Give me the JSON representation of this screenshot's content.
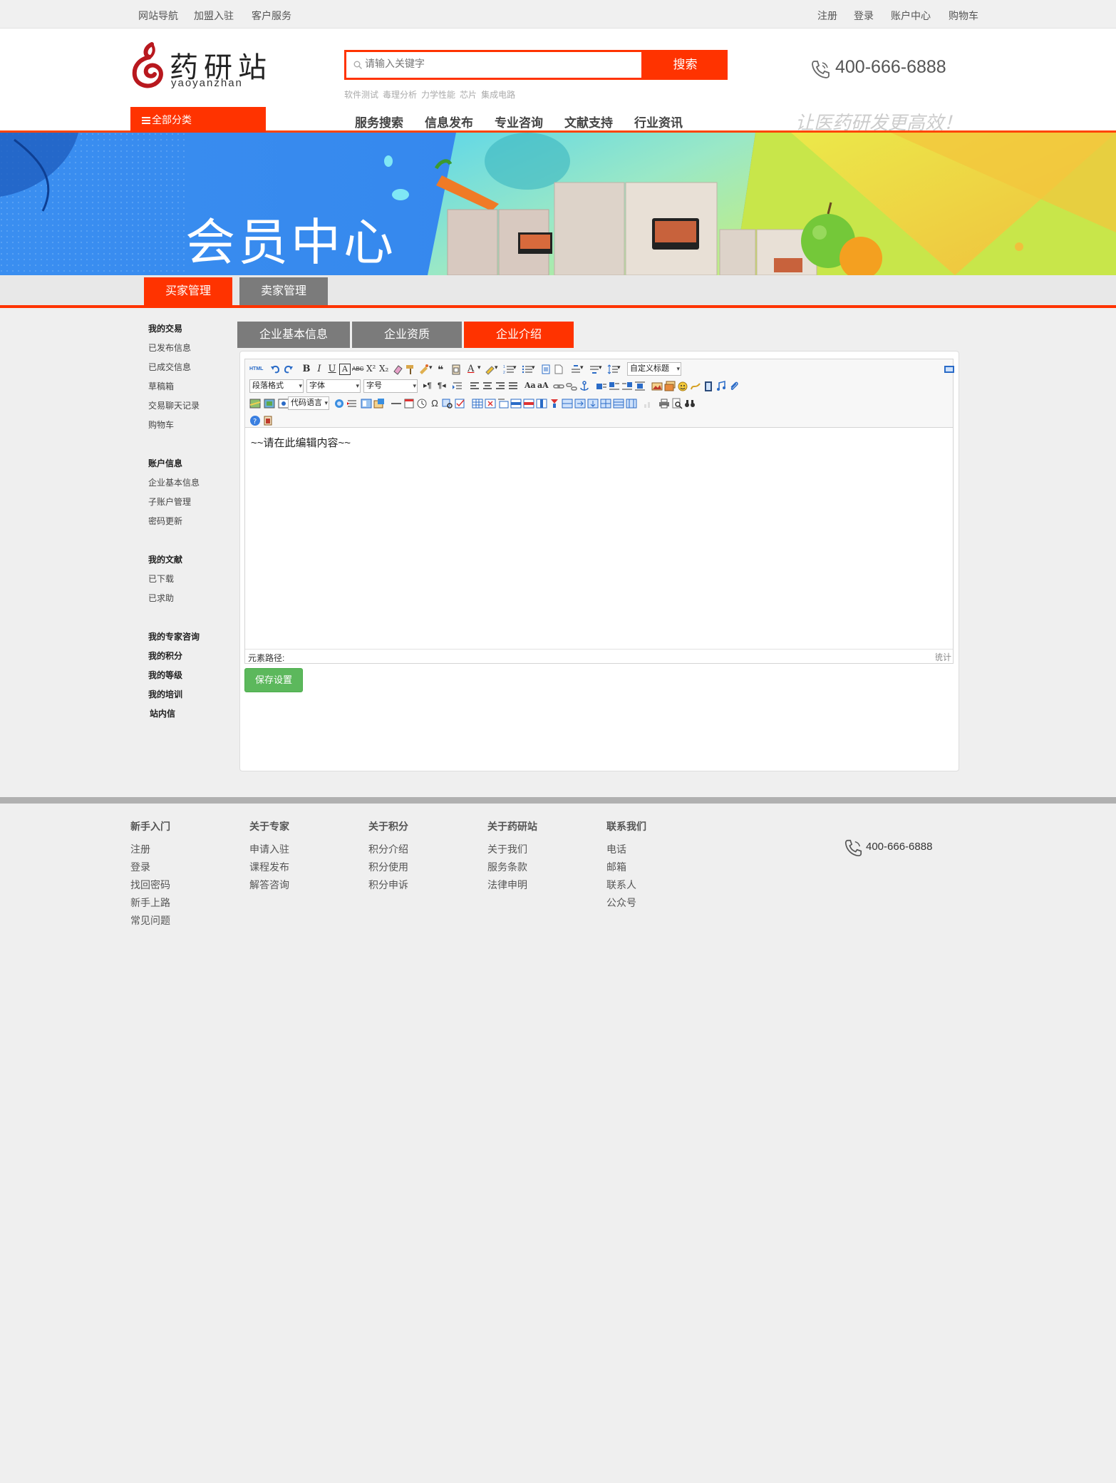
{
  "topbar": {
    "left": [
      "网站导航",
      "加盟入驻",
      "客户服务"
    ],
    "right": [
      "注册",
      "登录",
      "账户中心",
      "购物车"
    ]
  },
  "header": {
    "logo_cn": "药研站",
    "logo_en": "yaoyanzhan",
    "search_placeholder": "请输入关键字",
    "search_button": "搜索",
    "hotwords": [
      "软件测试",
      "毒理分析",
      "力学性能",
      "芯片",
      "集成电路"
    ],
    "phone": "400-666-6888",
    "all_categories": "全部分类",
    "nav": [
      "服务搜索",
      "信息发布",
      "专业咨询",
      "文献支持",
      "行业资讯"
    ],
    "slogan": "让医药研发更高效！",
    "brand_color": "#ff3300"
  },
  "banner": {
    "title": "会员中心"
  },
  "role_tabs": [
    {
      "label": "买家管理",
      "active": true
    },
    {
      "label": "卖家管理",
      "active": false
    }
  ],
  "sidebar": {
    "sections": [
      {
        "title": "我的交易",
        "items": [
          "已发布信息",
          "已成交信息",
          "草稿箱",
          "交易聊天记录",
          "购物车"
        ]
      },
      {
        "title": "账户信息",
        "items": [
          "企业基本信息",
          "子账户管理",
          "密码更新"
        ]
      },
      {
        "title": "我的文献",
        "items": [
          "已下载",
          "已求助"
        ]
      },
      {
        "title": "我的专家咨询",
        "items": []
      },
      {
        "title": "我的积分",
        "items": []
      },
      {
        "title": "我的等级",
        "items": []
      },
      {
        "title": "我的培训",
        "items": []
      },
      {
        "title": "站内信",
        "items": []
      }
    ]
  },
  "sub_tabs": [
    {
      "label": "企业基本信息",
      "active": false
    },
    {
      "label": "企业资质",
      "active": false
    },
    {
      "label": "企业介绍",
      "active": true
    }
  ],
  "editor": {
    "paragraph_select": "段落格式",
    "font_select": "字体",
    "size_select": "字号",
    "code_select": "代码语言",
    "custom_title": "自定义标题",
    "content": "~~请在此编辑内容~~",
    "path_label": "元素路径:",
    "word_count": "字数统计",
    "html_label": "HTML"
  },
  "save_button": "保存设置",
  "footer": {
    "columns": [
      {
        "title": "新手入门",
        "items": [
          "注册",
          "登录",
          "找回密码",
          "新手上路",
          "常见问题"
        ]
      },
      {
        "title": "关于专家",
        "items": [
          "申请入驻",
          "课程发布",
          "解答咨询"
        ]
      },
      {
        "title": "关于积分",
        "items": [
          "积分介绍",
          "积分使用",
          "积分申诉"
        ]
      },
      {
        "title": "关于药研站",
        "items": [
          "关于我们",
          "服务条款",
          "法律申明"
        ]
      },
      {
        "title": "联系我们",
        "items": [
          "电话",
          "邮箱",
          "联系人",
          "公众号"
        ]
      }
    ],
    "phone": "400-666-6888"
  }
}
